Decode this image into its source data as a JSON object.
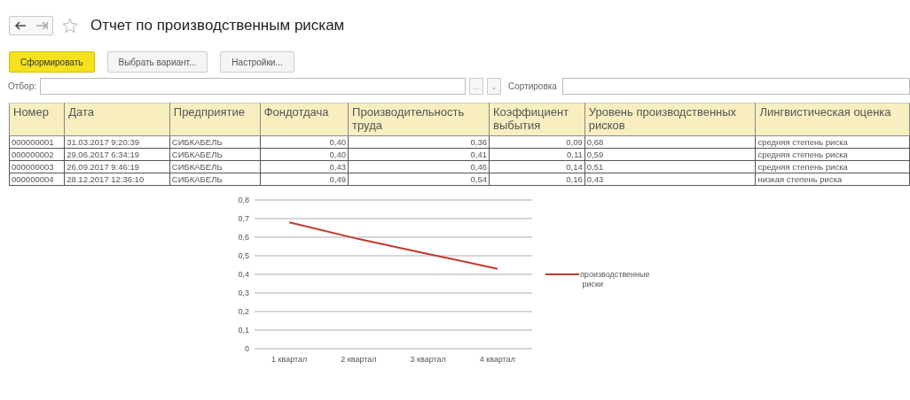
{
  "window": {
    "title": "Отчет по производственным рискам",
    "favorite": false
  },
  "buttons": [
    {
      "label": "Сформировать",
      "kind": "primary"
    },
    {
      "label": "Выбрать вариант...",
      "kind": "normal"
    },
    {
      "label": "Настройки...",
      "kind": "normal"
    }
  ],
  "filter": {
    "label": "Отбор:",
    "choose": "...",
    "dropdown": "⌄"
  },
  "sort": {
    "label": "Сортировка"
  },
  "table": {
    "columns": [
      "Номер",
      "Дата",
      "Предприятие",
      "Фондотдача",
      "Производительность труда",
      "Коэффициент выбытия",
      "Уровень производственных рисков",
      "Лингвистическая оценка"
    ],
    "rows": [
      [
        "000000001",
        "31.03.2017 9:20:39",
        "СИБКАБЕЛЬ",
        "0,40",
        "0,36",
        "0,09",
        "0,68",
        "средняя степень риска"
      ],
      [
        "000000002",
        "29.06.2017 6:34:19",
        "СИБКАБЕЛЬ",
        "0,40",
        "0,41",
        "0,11",
        "0,59",
        "средняя степень риска"
      ],
      [
        "000000003",
        "26.09.2017 9:46:19",
        "СИБКАБЕЛЬ",
        "0,43",
        "0,46",
        "0,14",
        "0,51",
        "средняя степень риска"
      ],
      [
        "000000004",
        "28.12.2017 12:36:10",
        "СИБКАБЕЛЬ",
        "0,49",
        "0,54",
        "0,16",
        "0,43",
        "низкая степень риска"
      ]
    ]
  },
  "chart_data": {
    "type": "line",
    "categories": [
      "1 квартал",
      "2 квартал",
      "3 квартал",
      "4 квартал"
    ],
    "series": [
      {
        "name": "производственные риски",
        "color": "#c0392b",
        "values": [
          0.68,
          0.59,
          0.51,
          0.43
        ]
      }
    ],
    "ylim": [
      0,
      0.8
    ],
    "grid": true,
    "yticks": [
      {
        "value": 0,
        "label": "0"
      },
      {
        "value": 0.1,
        "label": "0,1"
      },
      {
        "value": 0.2,
        "label": "0,2"
      },
      {
        "value": 0.3,
        "label": "0,3"
      },
      {
        "value": 0.4,
        "label": "0,4"
      },
      {
        "value": 0.5,
        "label": "0,5"
      },
      {
        "value": 0.6,
        "label": "0,6"
      },
      {
        "value": 0.7,
        "label": "0,7"
      },
      {
        "value": 0.8,
        "label": "0,8"
      }
    ]
  }
}
